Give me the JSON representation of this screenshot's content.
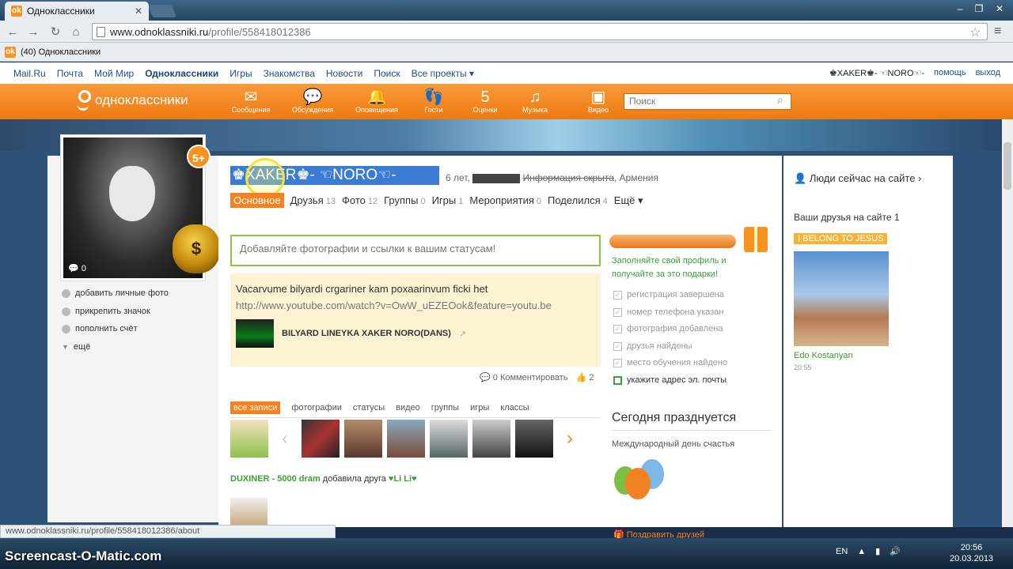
{
  "browser": {
    "tab_title": "Одноклассники",
    "url_main": "www.odnoklassniki.ru",
    "url_path": "/profile/558418012386",
    "bookmark": "(40) Одноклассники",
    "status_url": "www.odnoklassniki.ru/profile/558418012386/about"
  },
  "mailbar": {
    "links": [
      "Mail.Ru",
      "Почта",
      "Мой Мир",
      "Одноклассники",
      "Игры",
      "Знакомства",
      "Новости",
      "Поиск",
      "Все проекты ▾"
    ],
    "user": "♚XAKER♚- ☜NORO☜-",
    "help": "помощь",
    "logout": "выход"
  },
  "okbar": {
    "logo": "одноклассники",
    "nav": [
      {
        "label": "Сообщения",
        "icon": "✉"
      },
      {
        "label": "Обсуждения",
        "icon": "💬"
      },
      {
        "label": "Оповещения",
        "icon": "🔔"
      },
      {
        "label": "Гости",
        "icon": "👣"
      },
      {
        "label": "Оценки",
        "icon": "5"
      },
      {
        "label": "Музыка",
        "icon": "♫"
      },
      {
        "label": "Видео",
        "icon": "▣"
      }
    ],
    "search_placeholder": "Поиск"
  },
  "profile": {
    "name": "♚XAKER♚- ☜NORO☜-",
    "age": "6 лет,",
    "hidden": "Информация скрыта",
    "country": ", Армения",
    "photo_count": "0",
    "badge": "5+",
    "side_links": [
      "добавить личные фото",
      "прикрепить значок",
      "пополнить счёт",
      "ещё"
    ]
  },
  "tabs": [
    {
      "label": "Основное",
      "n": ""
    },
    {
      "label": "Друзья",
      "n": "13"
    },
    {
      "label": "Фото",
      "n": "12"
    },
    {
      "label": "Группы",
      "n": "0"
    },
    {
      "label": "Игры",
      "n": "1"
    },
    {
      "label": "Мероприятия",
      "n": "0"
    },
    {
      "label": "Поделился",
      "n": "4"
    },
    {
      "label": "Ещё ▾",
      "n": ""
    }
  ],
  "status_placeholder": "Добавляйте фотографии и ссылки к вашим статусам!",
  "post": {
    "text": "Vacarvume bilyardi crgariner kam poxaarinvum ficki het",
    "link": "http://www.youtube.com/watch?v=OwW_uEZEOok&feature=youtu.be",
    "video_title": "BILYARD LINEYKA XAKER NORO(DANS)",
    "comments": "0 Комментировать",
    "likes": "2"
  },
  "profile_fill": {
    "text": "Заполняйте свой профиль и получайте за это подарки!",
    "checks": [
      "регистрация завершена",
      "номер телефона указан",
      "фотография добавлена",
      "друзья найдены",
      "место обучения найдено",
      "укажите адрес эл. почты"
    ]
  },
  "feed": {
    "tabs": [
      "все записи",
      "фотографии",
      "статусы",
      "видео",
      "группы",
      "игры",
      "классы"
    ],
    "line_user": "DUXINER - 5000 dram",
    "line_action": " добавила друга ",
    "line_friend": "♥Li Li♥"
  },
  "holiday": {
    "title": "Сегодня празднуется",
    "text": "Международный день счастья",
    "congrats": "Поздравить друзей"
  },
  "right": {
    "online": "Люди сейчас на сайте ›",
    "friends_online": "Ваши друзья на сайте 1",
    "tag": "I BELONG TO JESUS",
    "friend_name": "Edo Kostanyan",
    "friend_time": "20:55"
  },
  "taskbar": {
    "watermark": "Screencast-O-Matic.com",
    "lang": "EN",
    "time": "20:56",
    "date": "20.03.2013"
  }
}
